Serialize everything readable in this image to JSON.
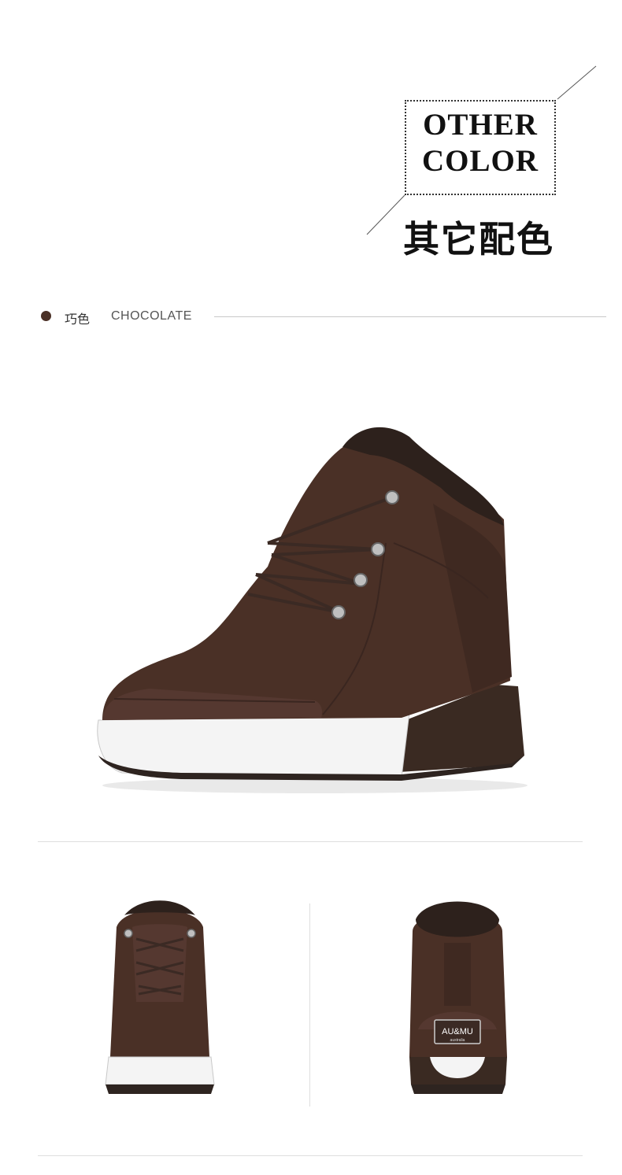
{
  "header": {
    "title_line1": "OTHER",
    "title_line2": "COLOR",
    "title_cn": "其它配色"
  },
  "color_variant": {
    "label_cn": "巧色",
    "label_en": "CHOCOLATE",
    "swatch_color": "#4a3026"
  },
  "images": {
    "main": "chocolate-boot-three-quarter-view",
    "front": "chocolate-boot-front-view",
    "back": "chocolate-boot-back-view"
  },
  "brand_tag": {
    "logo": "AU&MU",
    "sub": "australia"
  },
  "colors": {
    "suede": "#4a3026",
    "sole_white": "#f4f4f4",
    "heel_dark": "#3a2a22"
  }
}
